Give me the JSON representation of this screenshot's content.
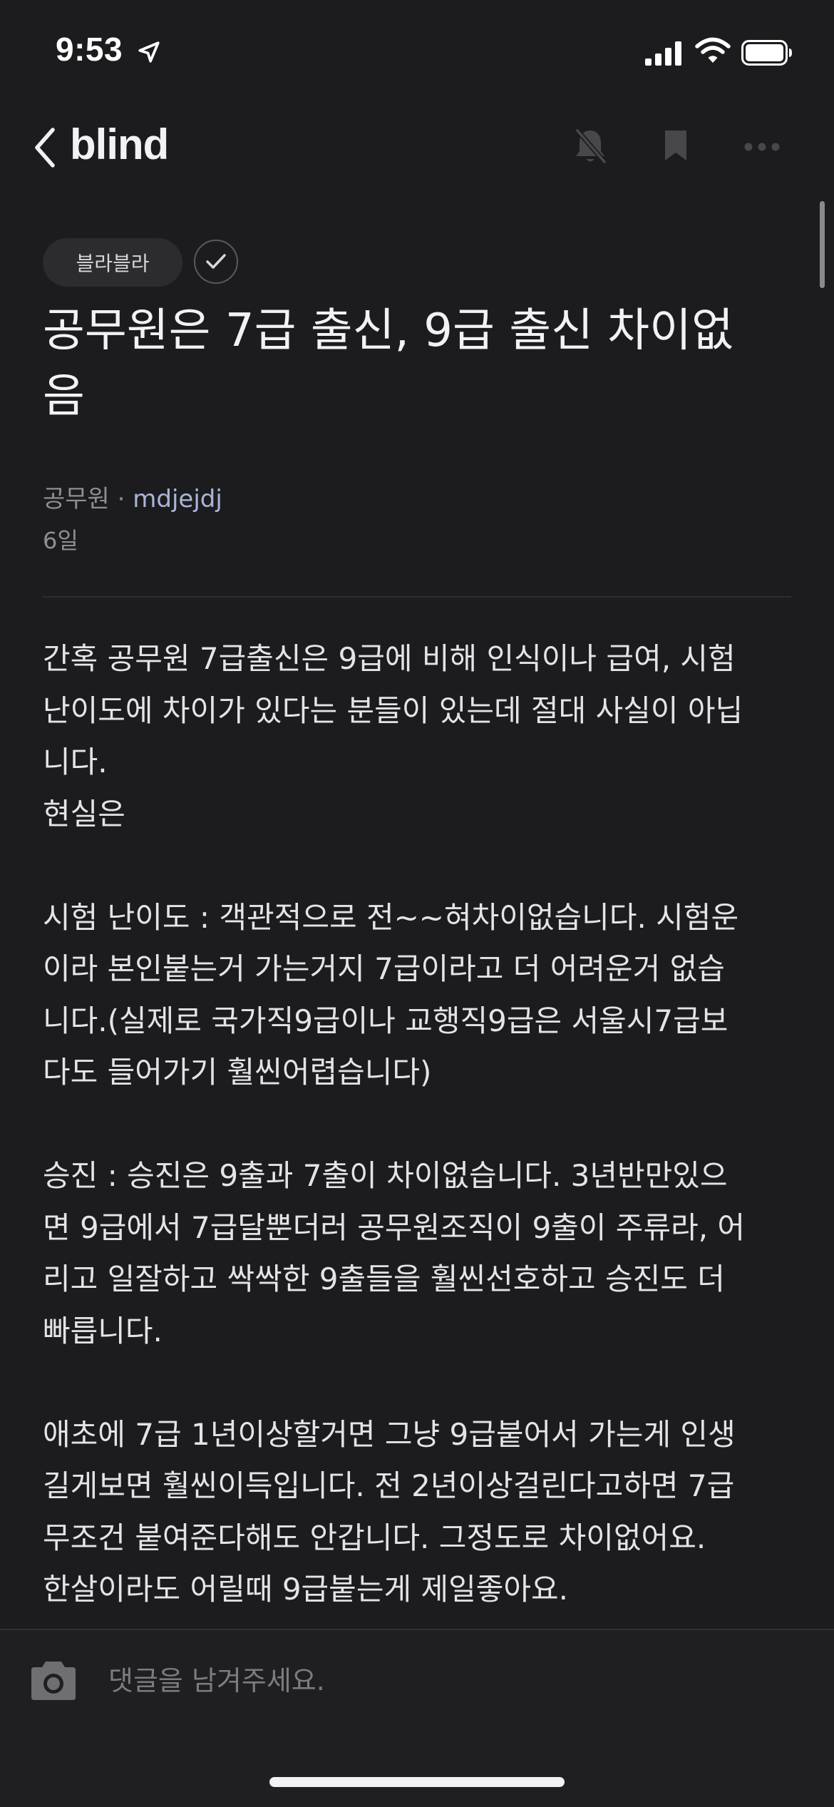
{
  "status_bar": {
    "time": "9:53",
    "icons": [
      "location-arrow-icon",
      "signal-icon",
      "wifi-icon",
      "battery-icon"
    ]
  },
  "nav": {
    "logo": "blind",
    "icons": [
      "back-icon",
      "bell-off-icon",
      "bookmark-icon",
      "more-icon"
    ]
  },
  "post": {
    "category": "블라블라",
    "title": "공무원은 7급 출신, 9급 출신 차이없\n음",
    "company": "공무원",
    "separator": " · ",
    "author": "mdjejdj",
    "date": "6일",
    "body": "간혹 공무원 7급출신은 9급에 비해 인식이나 급여, 시험\n난이도에 차이가 있다는 분들이 있는데 절대 사실이 아닙\n니다.\n현실은\n\n시험 난이도 : 객관적으로 전~~혀차이없습니다. 시험운\n이라 본인붙는거 가는거지 7급이라고 더 어려운거 없습\n니다.(실제로 국가직9급이나 교행직9급은 서울시7급보\n다도 들어가기 훨씬어렵습니다)\n\n승진 : 승진은 9출과 7출이 차이없습니다. 3년반만있으\n면 9급에서 7급달뿐더러 공무원조직이 9출이 주류라, 어\n리고 일잘하고 싹싹한 9출들을 훨씬선호하고 승진도 더\n빠릅니다.\n\n애초에 7급 1년이상할거면 그냥 9급붙어서 가는게 인생\n길게보면 훨씬이득입니다. 전 2년이상걸린다고하면 7급\n무조건 붙여준다해도 안갑니다. 그정도로 차이없어요.\n한살이라도 어릴때 9급붙는게 제일좋아요."
  },
  "comment": {
    "placeholder": "댓글을 남겨주세요."
  },
  "colors": {
    "background": "#1c1c1e",
    "author_link": "#a9b6d8",
    "muted_text": "#8e8e93"
  }
}
